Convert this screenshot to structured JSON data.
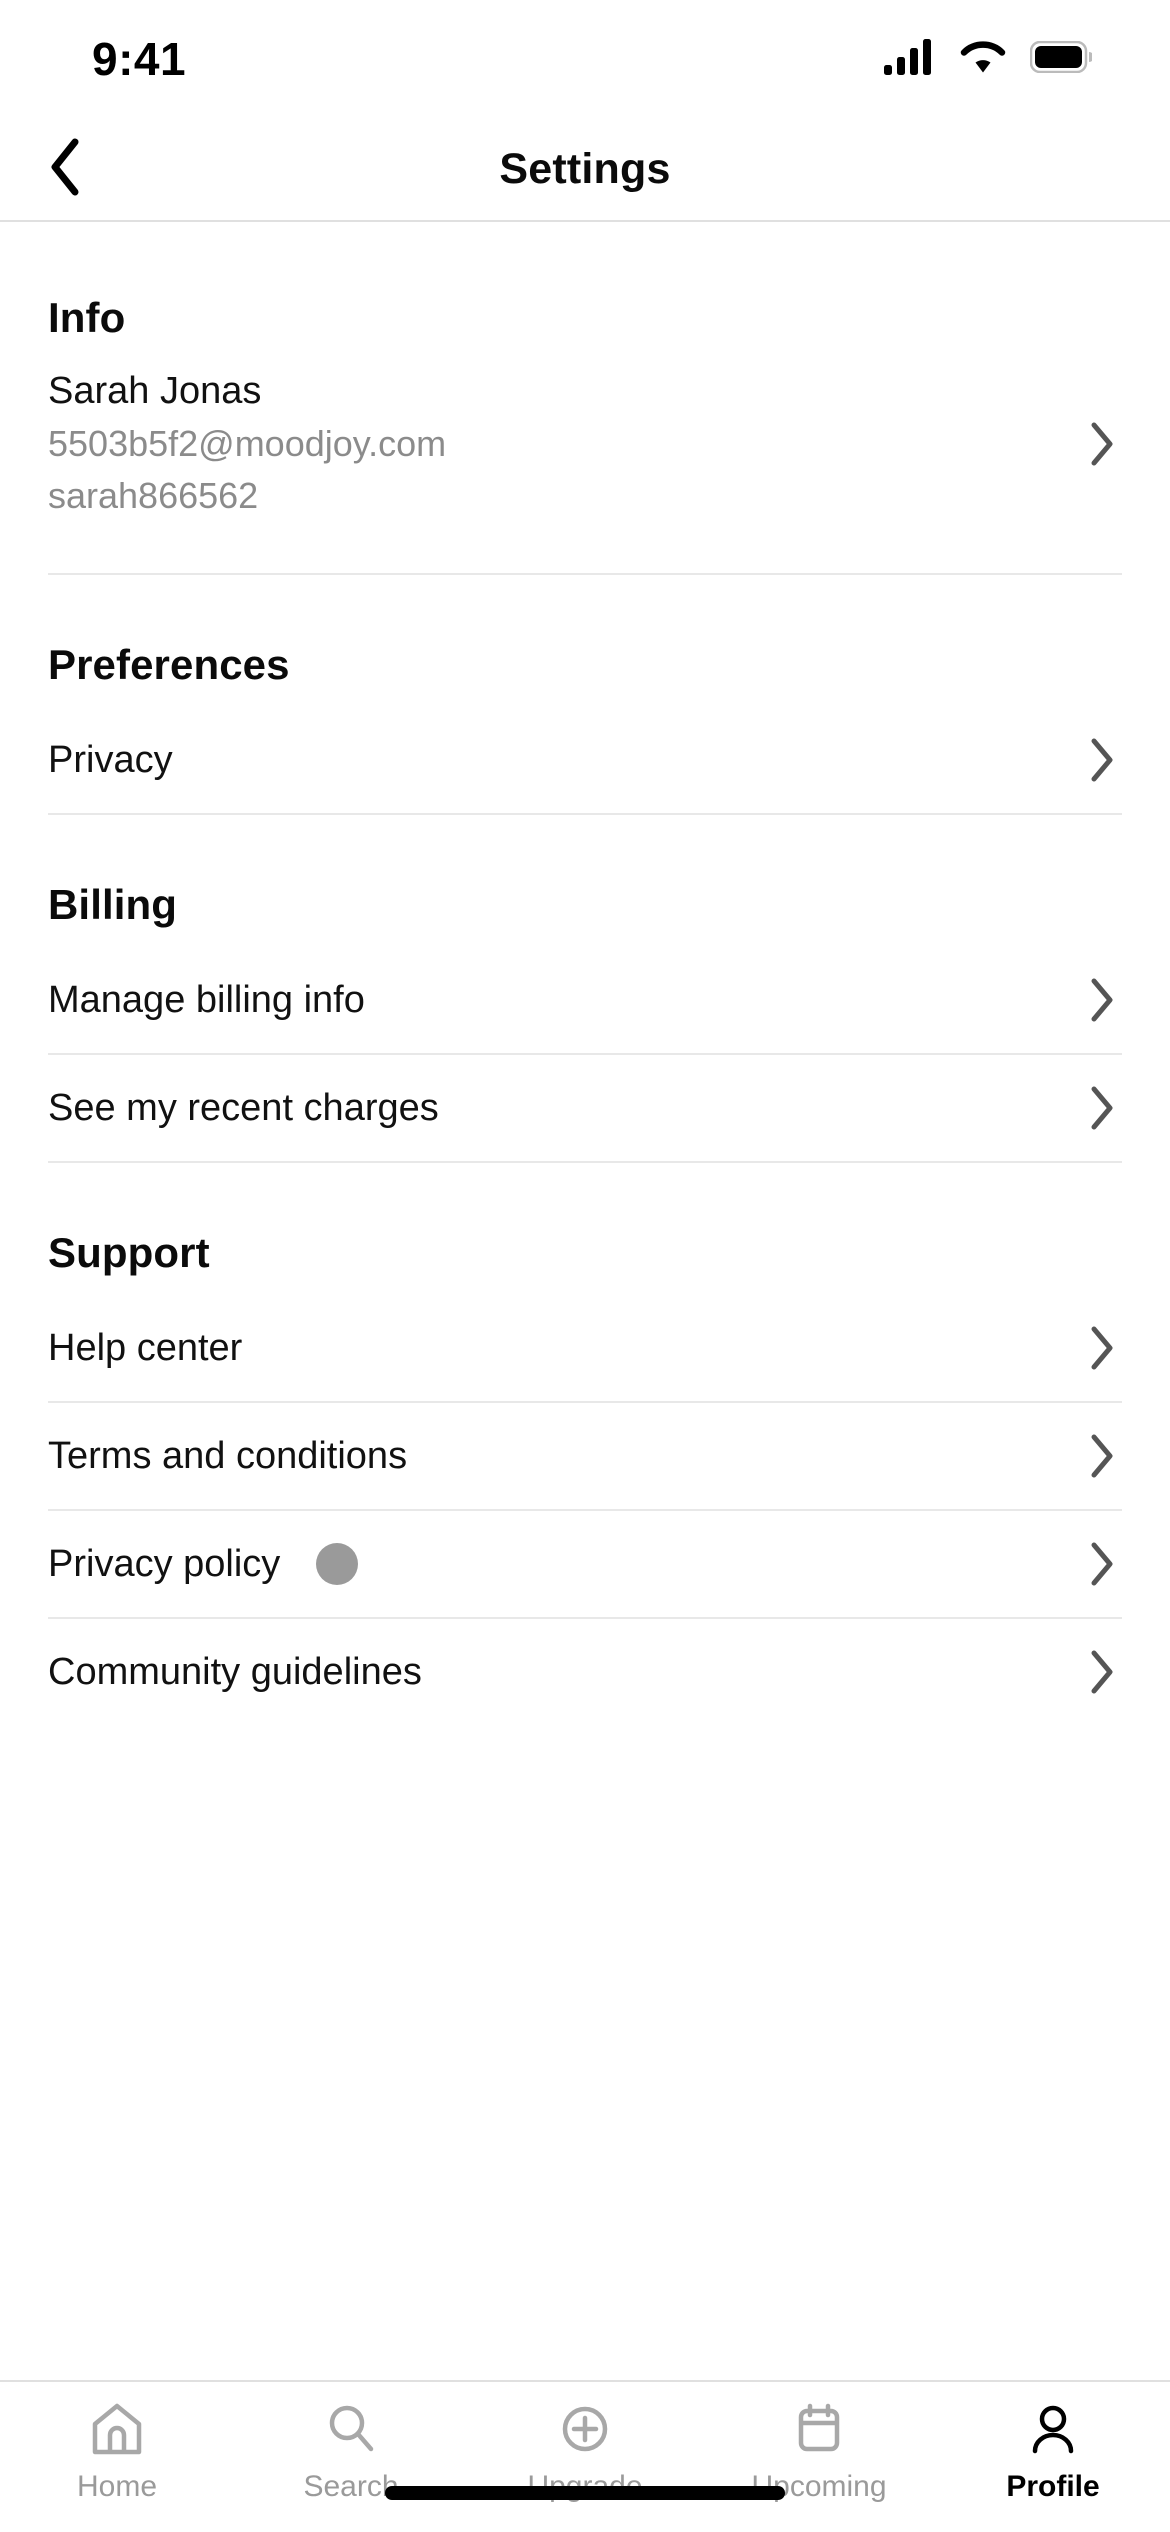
{
  "status_bar": {
    "time": "9:41",
    "cellular_icon": "signal-bars-icon",
    "wifi_icon": "wifi-icon",
    "battery_icon": "battery-icon"
  },
  "nav": {
    "back_icon": "chevron-left-icon",
    "title": "Settings"
  },
  "sections": [
    {
      "id": "info",
      "title": "Info",
      "user": {
        "name": "Sarah Jonas",
        "email": "5503b5f2@moodjoy.com",
        "handle": "sarah866562"
      }
    },
    {
      "id": "preferences",
      "title": "Preferences",
      "rows": [
        {
          "label": "Privacy"
        }
      ]
    },
    {
      "id": "billing",
      "title": "Billing",
      "rows": [
        {
          "label": "Manage billing info"
        },
        {
          "label": "See my recent charges"
        }
      ]
    },
    {
      "id": "support",
      "title": "Support",
      "rows": [
        {
          "label": "Help center"
        },
        {
          "label": "Terms and conditions"
        },
        {
          "label": "Privacy policy",
          "badge": true
        },
        {
          "label": "Community guidelines"
        }
      ]
    }
  ],
  "tabbar": {
    "items": [
      {
        "label": "Home",
        "icon": "home-icon",
        "active": false
      },
      {
        "label": "Search",
        "icon": "search-icon",
        "active": false
      },
      {
        "label": "Upgrade",
        "icon": "plus-circle-icon",
        "active": false
      },
      {
        "label": "Upcoming",
        "icon": "calendar-icon",
        "active": false
      },
      {
        "label": "Profile",
        "icon": "person-icon",
        "active": true
      }
    ]
  },
  "colors": {
    "text_primary": "#111111",
    "text_muted": "#8b8b8b",
    "divider": "#e8e8e8",
    "badge": "#9a9a9a",
    "tab_inactive": "#9a9a9a",
    "tab_active": "#000000"
  }
}
